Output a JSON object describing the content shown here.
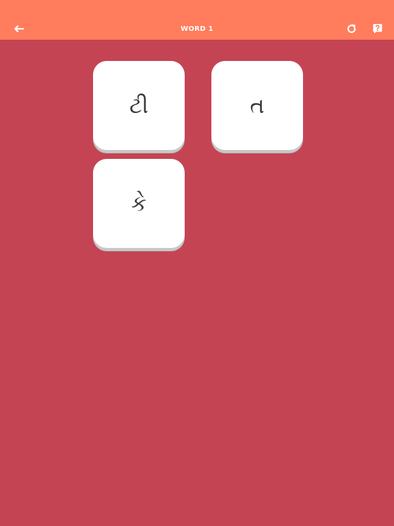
{
  "header": {
    "title": "WORD 1",
    "back_icon": "back-arrow-icon",
    "refresh_icon": "refresh-icon",
    "hint_icon": "hint-question-icon"
  },
  "tiles": [
    {
      "letter": "ટી"
    },
    {
      "letter": "ત"
    },
    {
      "letter": "કે"
    }
  ],
  "colors": {
    "header_bg": "#ff7c5c",
    "background": "#c44454",
    "tile": "#ffffff"
  }
}
